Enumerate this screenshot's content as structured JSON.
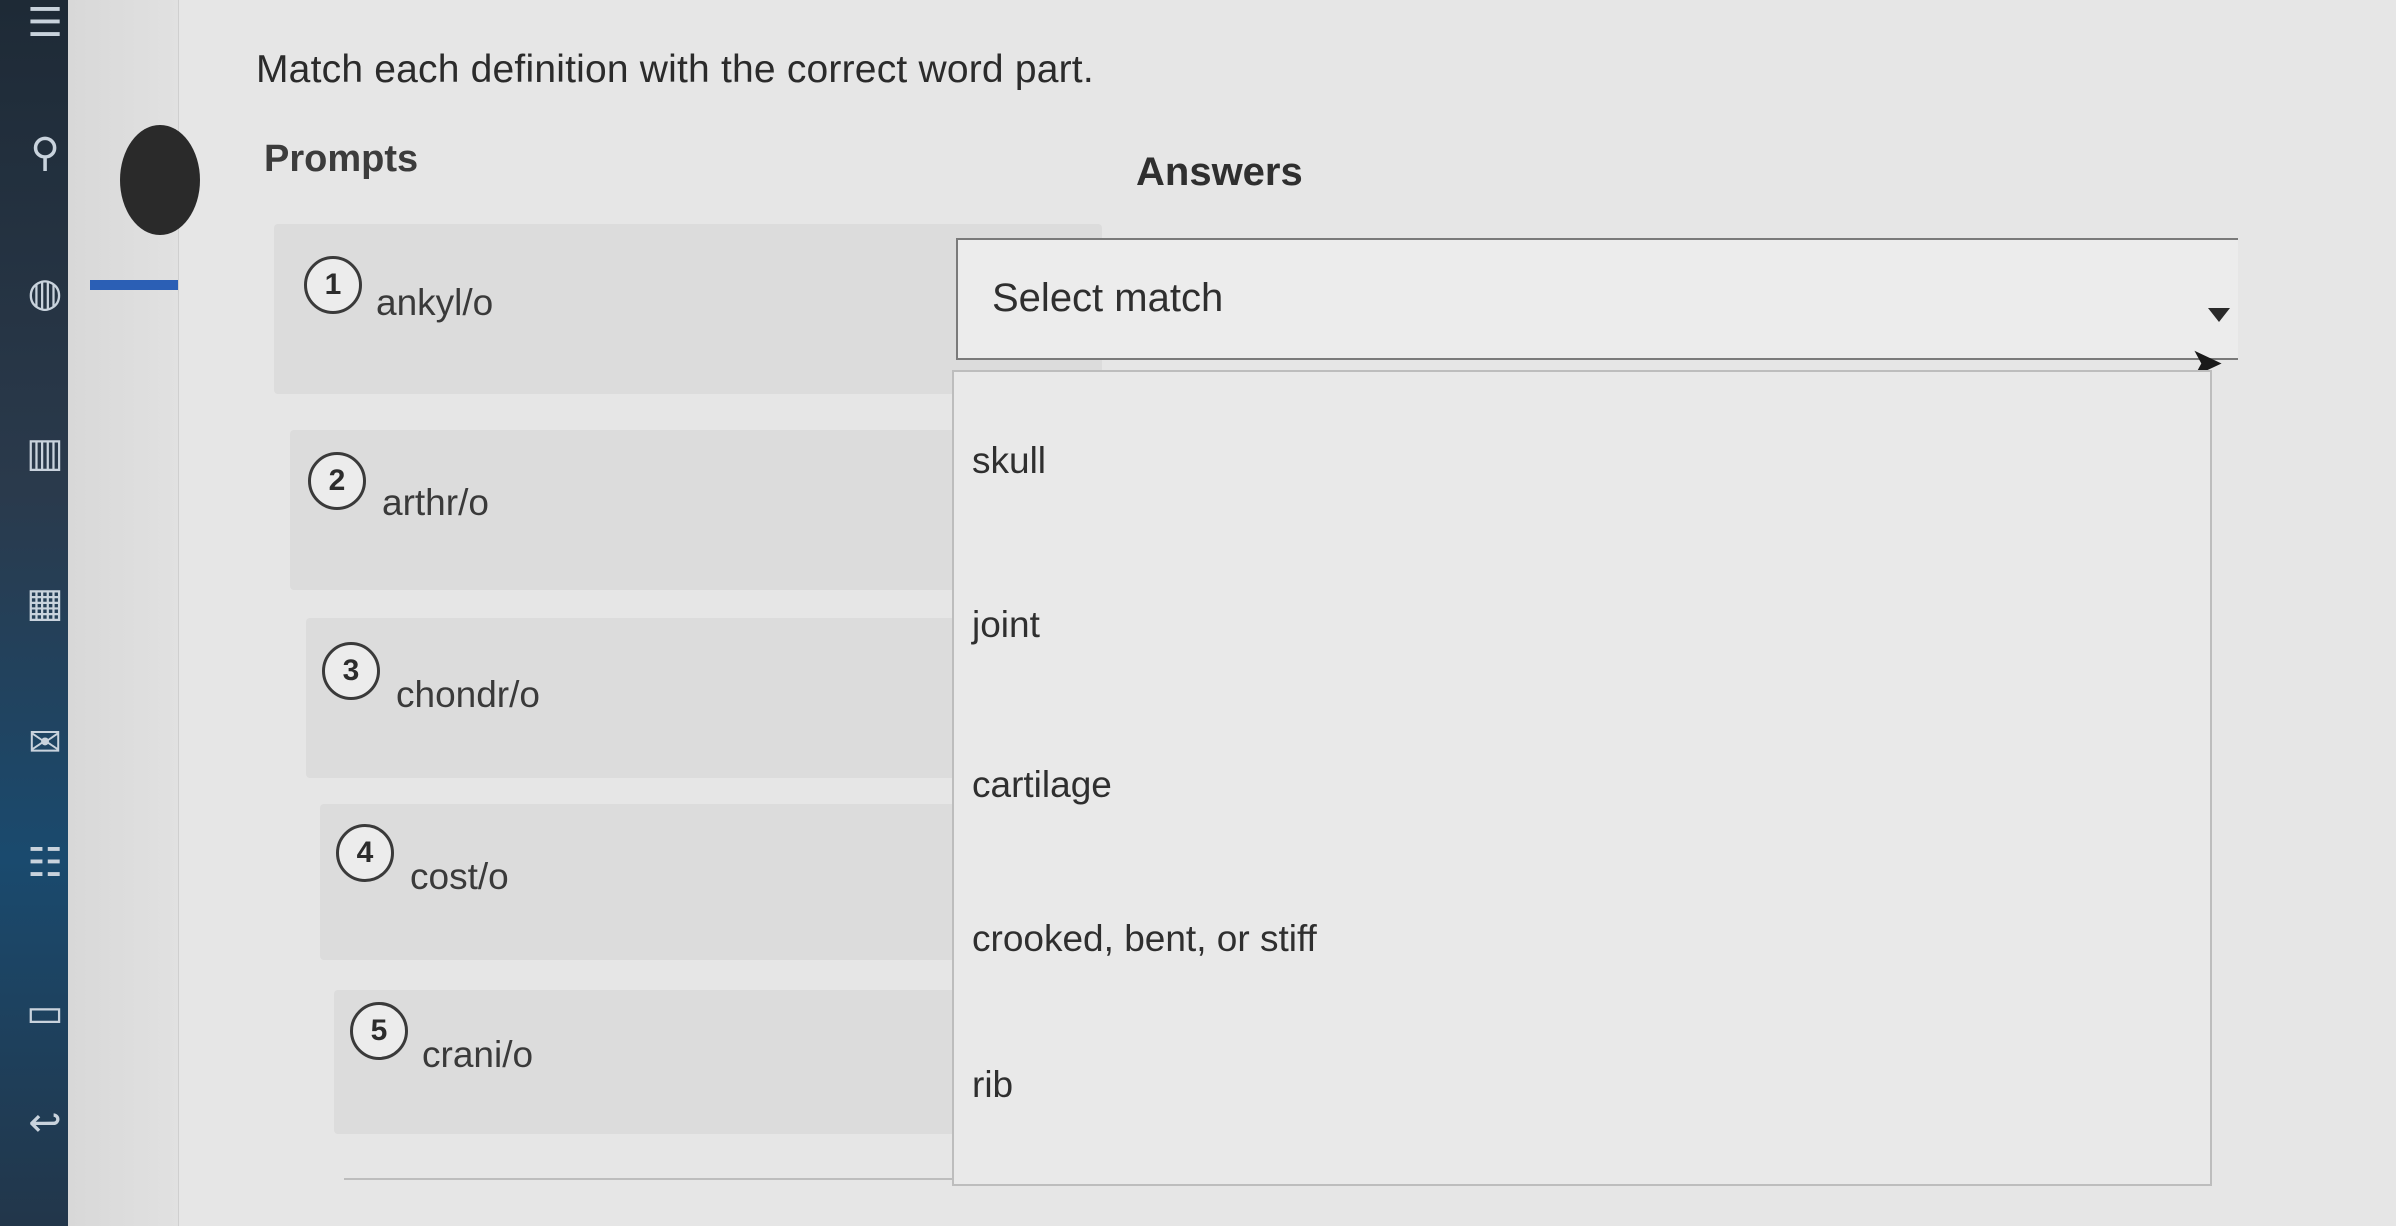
{
  "page": {
    "instruction": "Match each definition with the correct word part.",
    "prompts_heading": "Prompts",
    "answers_heading": "Answers"
  },
  "prompts": [
    {
      "number": "1",
      "text": "ankyl/o"
    },
    {
      "number": "2",
      "text": "arthr/o"
    },
    {
      "number": "3",
      "text": "chondr/o"
    },
    {
      "number": "4",
      "text": "cost/o"
    },
    {
      "number": "5",
      "text": "crani/o"
    }
  ],
  "answer_select": {
    "selected_value": "Select match",
    "options": [
      "skull",
      "joint",
      "cartilage",
      "crooked, bent, or stiff",
      "rib"
    ]
  },
  "icons": {
    "dropdown": "chevron-down-icon",
    "cursor": "mouse-pointer-icon",
    "sidebar": [
      "menu-icon",
      "user-icon",
      "globe-icon",
      "book-icon",
      "calendar-icon",
      "mail-icon",
      "list-icon",
      "file-icon",
      "reply-icon"
    ]
  },
  "colors": {
    "background": "#e6e6e6",
    "prompt_row": "#dcdcdc",
    "accent": "#2b5fb5",
    "text": "#2f2f2f"
  }
}
